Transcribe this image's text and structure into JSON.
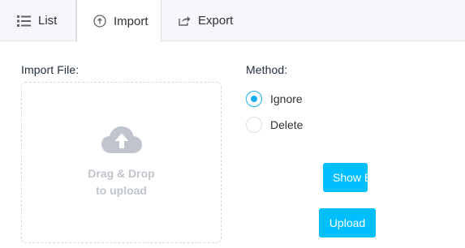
{
  "tabs": {
    "list": {
      "label": "List",
      "icon": "list-icon"
    },
    "import": {
      "label": "Import",
      "icon": "upload-circle-icon",
      "active": true
    },
    "export": {
      "label": "Export",
      "icon": "share-export-icon"
    }
  },
  "import_file": {
    "label": "Import File:",
    "dropzone": {
      "line1": "Drag & Drop",
      "line2": "to upload",
      "icon": "cloud-upload-icon"
    }
  },
  "method": {
    "label": "Method:",
    "options": [
      {
        "label": "Ignore",
        "checked": true
      },
      {
        "label": "Delete",
        "checked": false
      }
    ]
  },
  "buttons": {
    "show": "Show E",
    "upload": "Upload"
  },
  "colors": {
    "accent": "#00bfff",
    "radio_checked": "#1aaef0",
    "tabbar_bg": "#f5f7fa",
    "dropzone_text": "#c0c4cc"
  }
}
